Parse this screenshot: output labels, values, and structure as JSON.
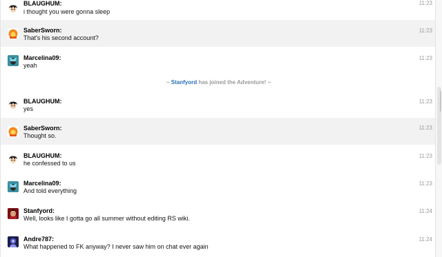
{
  "messages": [
    {
      "user": "BLAUGHUM:",
      "text": "i thought you were gonna sleep",
      "time": "11:23",
      "avatar": "dark-hair-avatar"
    },
    {
      "user": "SaberSworn:",
      "text": "That's his second account?",
      "time": "11:23",
      "avatar": "orange-avatar"
    },
    {
      "user": "Marcelina09:",
      "text": "yeah",
      "time": "11:23",
      "avatar": "teal-avatar"
    },
    {
      "user": "BLAUGHUM:",
      "text": "yes",
      "time": "11:23",
      "avatar": "dark-hair-avatar"
    },
    {
      "user": "SaberSworn:",
      "text": "Thought so.",
      "time": "11:23",
      "avatar": "orange-avatar"
    },
    {
      "user": "BLAUGHUM:",
      "text": "he confessed to us",
      "time": "11:23",
      "avatar": "dark-hair-avatar"
    },
    {
      "user": "Marcelina09:",
      "text": "And told everything",
      "time": "11:23",
      "avatar": "teal-avatar"
    },
    {
      "user": "Stanfyord:",
      "text": "Well, looks like I gotta go all summer without editing RS wiki.",
      "time": "11:24",
      "avatar": "red-avatar"
    },
    {
      "user": "Andre787:",
      "text": "What happened to FK anyway? I never saw him on chat ever again",
      "time": "11:24",
      "avatar": "purple-avatar"
    }
  ],
  "join_notice": {
    "prefix": "~ ",
    "user": "Stanfyord",
    "suffix": " has joined the Adventure! ~"
  },
  "colors": {
    "alt_row": "#f2f2f2",
    "join_user": "#2a6fb8",
    "timestamp": "#9a9a9a"
  }
}
